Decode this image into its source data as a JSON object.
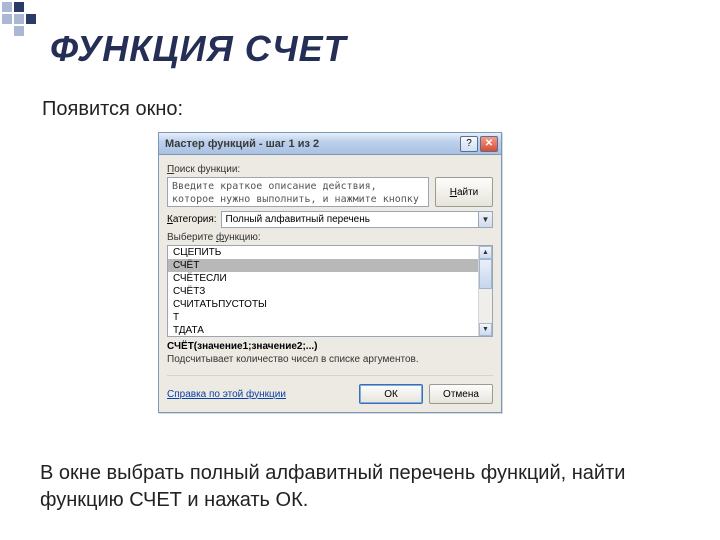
{
  "slide": {
    "title": "ФУНКЦИЯ СЧЕТ",
    "caption_above": "Появится окно:",
    "caption_below": "В окне выбрать полный алфавитный перечень функций, найти функцию СЧЕТ и нажать ОК."
  },
  "dialog": {
    "title": "Мастер функций - шаг 1 из 2",
    "help_btn": "?",
    "close_btn": "✕",
    "search_label": "Поиск функции:",
    "search_placeholder": "Введите краткое описание действия, которое нужно выполнить, и нажмите кнопку \"Найти\"",
    "find_btn": "Найти",
    "category_label": "Категория:",
    "category_value": "Полный алфавитный перечень",
    "select_label": "Выберите функцию:",
    "functions": [
      "СЦЕПИТЬ",
      "СЧЁТ",
      "СЧЁТЕСЛИ",
      "СЧЁТЗ",
      "СЧИТАТЬПУСТОТЫ",
      "Т",
      "ТДАТА"
    ],
    "selected_index": 1,
    "signature": "СЧЁТ(значение1;значение2;...)",
    "description": "Подсчитывает количество чисел в списке аргументов.",
    "help_link": "Справка по этой функции",
    "ok_btn": "ОК",
    "cancel_btn": "Отмена"
  }
}
